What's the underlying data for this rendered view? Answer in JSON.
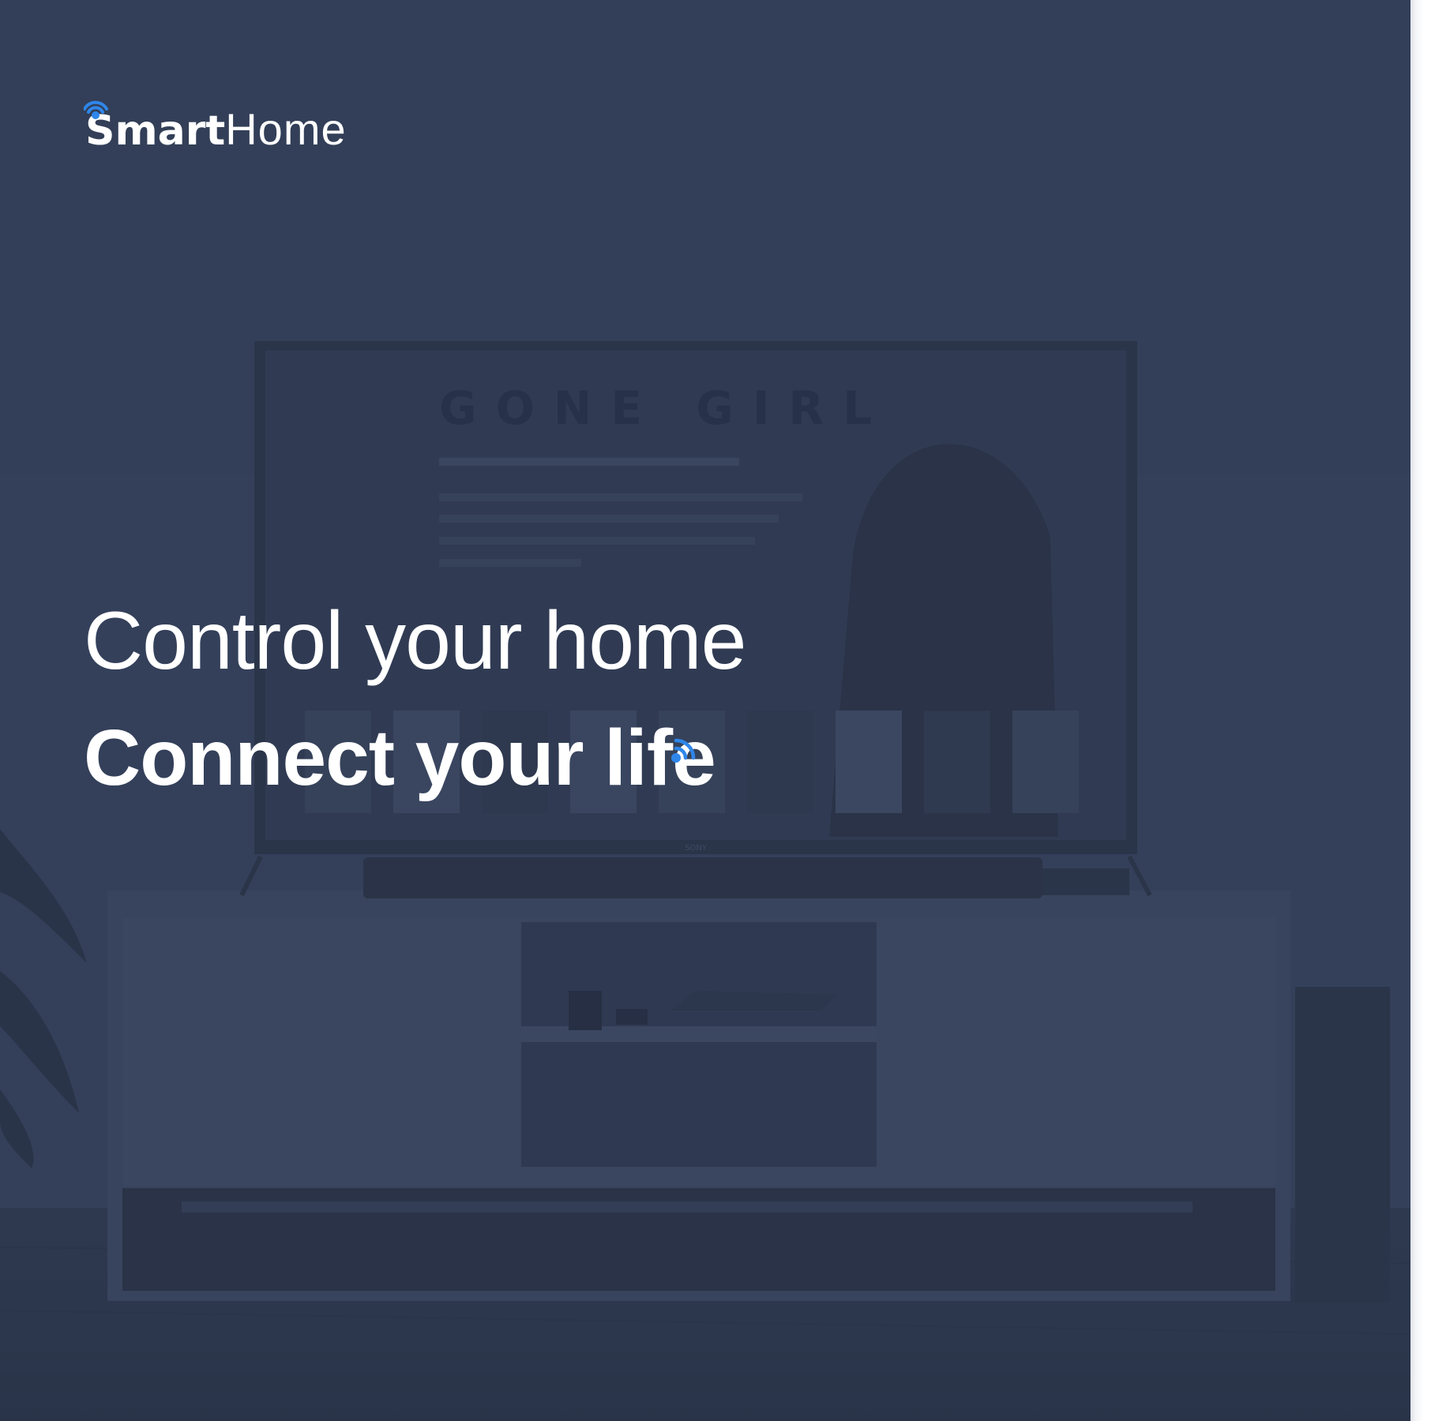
{
  "brand": {
    "name_bold": "Smart",
    "name_light": "Home",
    "accent_color": "#2f86ea",
    "logo_icon": "wifi-signal-icon"
  },
  "hero": {
    "headline": "Control your home",
    "subheadline": "Connect your life",
    "subheadline_icon": "wifi-signal-icon",
    "overlay_color": "#34405a",
    "text_color": "#ffffff"
  },
  "background": {
    "tv_screen_title": "GONE GIRL",
    "tv_brand": "SONY"
  }
}
